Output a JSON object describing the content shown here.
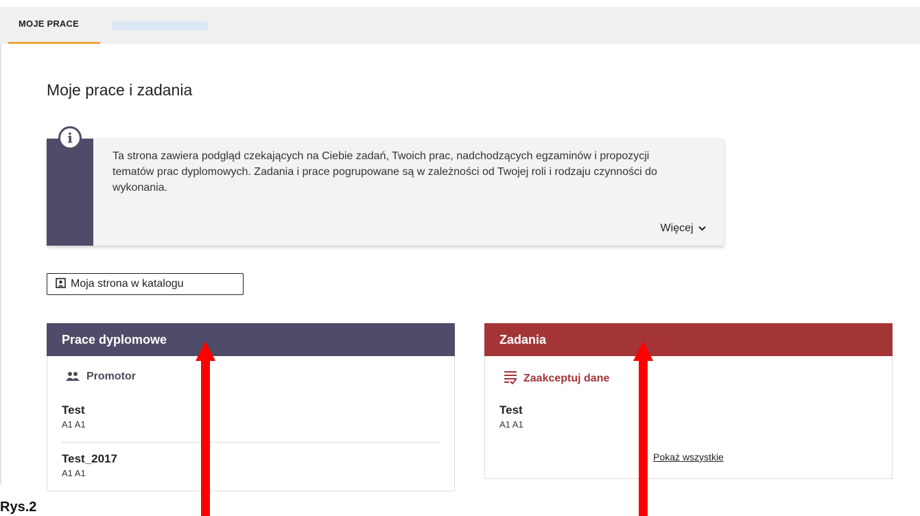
{
  "tabs": [
    {
      "label": "MOJE PRACE",
      "active": true
    }
  ],
  "page": {
    "title": "Moje prace i zadania"
  },
  "info": {
    "text": "Ta strona zawiera podgląd czekających na Ciebie zadań, Twoich prac, nadchodzących egzaminów i propozycji tematów prac dyplomowych. Zadania i prace pogrupowane są w zależności od Twojej roli i rodzaju czynności do wykonania.",
    "more_label": "Więcej"
  },
  "catalog_button": {
    "label": "Moja strona w katalogu"
  },
  "panels": {
    "theses": {
      "title": "Prace dyplomowe",
      "role": "Promotor",
      "items": [
        {
          "title": "Test",
          "subtitle": "A1 A1"
        },
        {
          "title": "Test_2017",
          "subtitle": "A1 A1"
        }
      ]
    },
    "tasks": {
      "title": "Zadania",
      "action": "Zaakceptuj dane",
      "items": [
        {
          "title": "Test",
          "subtitle": "A1 A1"
        }
      ],
      "show_all_label": "Pokaż wszystkie"
    }
  },
  "caption": "Rys.2",
  "colors": {
    "accent_orange": "#f2a33a",
    "theses_header": "#4e4c68",
    "tasks_header": "#a33537",
    "annotation_arrow": "#ff0000"
  }
}
